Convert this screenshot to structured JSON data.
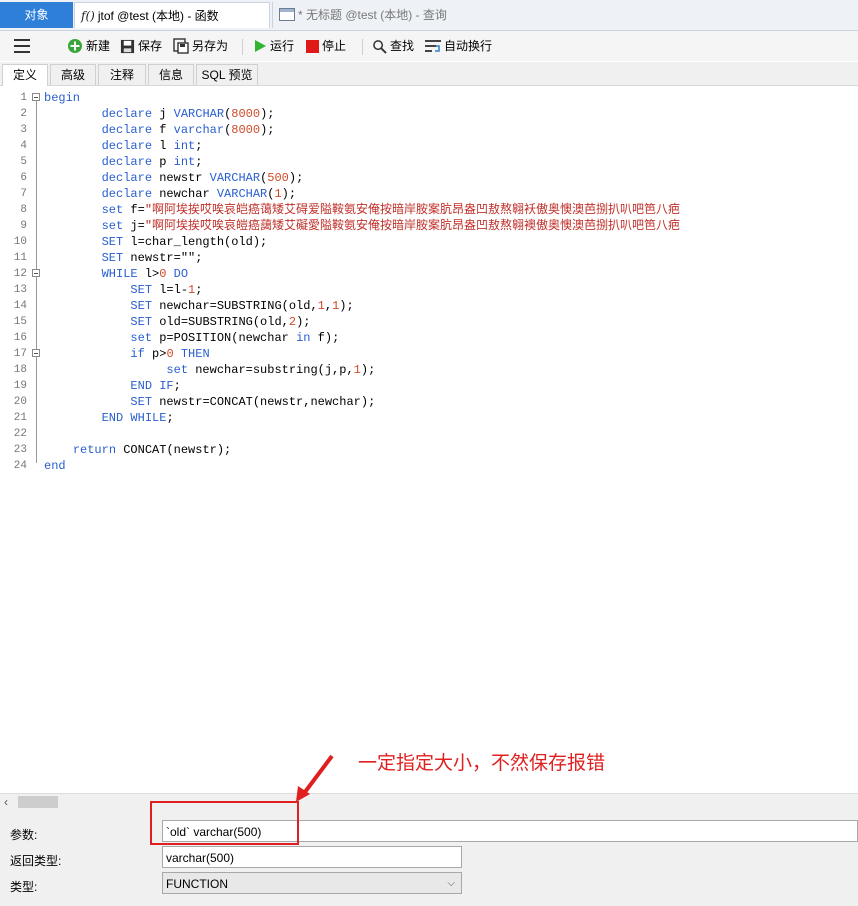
{
  "tabs": {
    "objects": "对象",
    "function_tab": "jtof @test (本地) - 函数",
    "query_tab": "* 无标题 @test (本地) - 查询"
  },
  "toolbar": {
    "new": "新建",
    "save": "保存",
    "save_as": "另存为",
    "run": "运行",
    "stop": "停止",
    "find": "查找",
    "word_wrap": "自动换行"
  },
  "subtabs": [
    "定义",
    "高级",
    "注释",
    "信息",
    "SQL 预览"
  ],
  "code_lines": [
    "begin",
    "        declare j VARCHAR(8000);",
    "        declare f varchar(8000);",
    "        declare l int;",
    "        declare p int;",
    "        declare newstr VARCHAR(500);",
    "        declare newchar VARCHAR(1);",
    "        set f=\"啊阿埃挨哎唉哀皑癌蔼矮艾碍爱隘鞍氨安俺按暗岸胺案肮昂盎凹敖熬翱袄傲奥懊澳芭捌扒叭吧笆八疤",
    "        set j=\"啊阿埃挨哎唉哀皚癌藹矮艾礙愛隘鞍氨安俺按暗岸胺案肮昂盎凹敖熬翱襖傲奧懊澳芭捌扒叭吧笆八疤",
    "        SET l=char_length(old);",
    "        SET newstr=\"\";",
    "        WHILE l>0 DO",
    "            SET l=l-1;",
    "            SET newchar=SUBSTRING(old,1,1);",
    "            SET old=SUBSTRING(old,2);",
    "            set p=POSITION(newchar in f);",
    "            if p>0 THEN",
    "                 set newchar=substring(j,p,1);",
    "            END IF;",
    "            SET newstr=CONCAT(newstr,newchar);",
    "        END WHILE;",
    "",
    "    return CONCAT(newstr);",
    "end"
  ],
  "properties": {
    "params_label": "参数:",
    "params_value": "`old` varchar(500)",
    "return_label": "返回类型:",
    "return_value": "varchar(500)",
    "type_label": "类型:",
    "type_value": "FUNCTION"
  },
  "annotation": "一定指定大小，不然保存报错",
  "colors": {
    "keyword": "#2a5fd1",
    "number": "#d04a2a",
    "string": "#c0302a",
    "annotation": "#e02020",
    "active_tab": "#2d7fd8"
  }
}
